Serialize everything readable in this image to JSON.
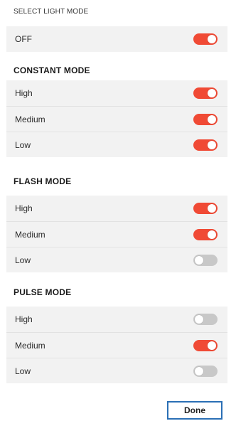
{
  "title": "SELECT LIGHT MODE",
  "off_row": {
    "label": "OFF",
    "toggle": "on"
  },
  "sections": [
    {
      "heading": "CONSTANT MODE",
      "items": [
        {
          "label": "High",
          "toggle": "on"
        },
        {
          "label": "Medium",
          "toggle": "on"
        },
        {
          "label": "Low",
          "toggle": "on"
        }
      ]
    },
    {
      "heading": "FLASH MODE",
      "items": [
        {
          "label": "High",
          "toggle": "on"
        },
        {
          "label": "Medium",
          "toggle": "on"
        },
        {
          "label": "Low",
          "toggle": "off"
        }
      ]
    },
    {
      "heading": "PULSE MODE",
      "items": [
        {
          "label": "High",
          "toggle": "off"
        },
        {
          "label": "Medium",
          "toggle": "on"
        },
        {
          "label": "Low",
          "toggle": "off"
        }
      ]
    }
  ],
  "done_label": "Done",
  "colors": {
    "toggle_on": "#f04a35",
    "toggle_off": "#c8c8c8",
    "row_background": "#f2f2f2",
    "done_border": "#2a6fb5"
  }
}
